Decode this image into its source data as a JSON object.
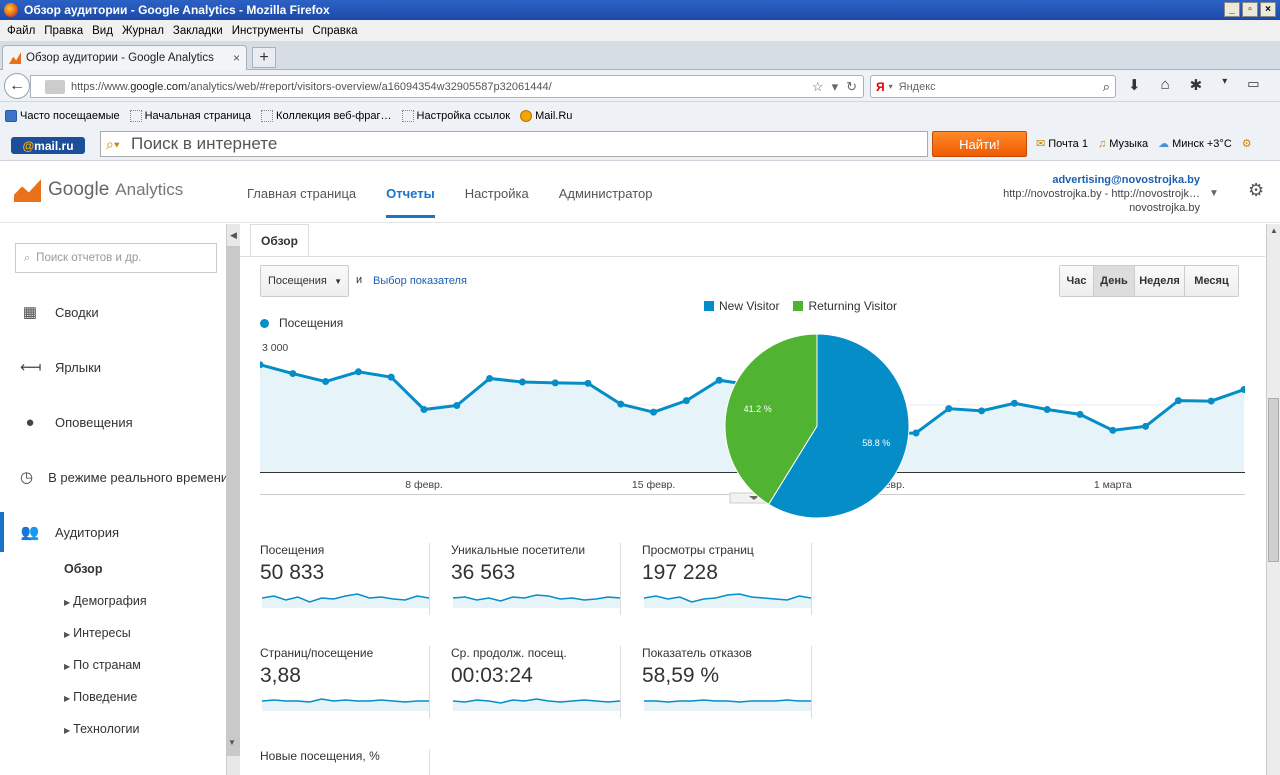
{
  "window": {
    "title": "Обзор аудитории - Google Analytics - Mozilla Firefox"
  },
  "menu": [
    "Файл",
    "Правка",
    "Вид",
    "Журнал",
    "Закладки",
    "Инструменты",
    "Справка"
  ],
  "tab": {
    "label": "Обзор аудитории - Google Analytics",
    "new_label": "+"
  },
  "url": {
    "prefix": "https://www.",
    "host": "google.com",
    "path": "/analytics/web/#report/visitors-overview/a16094354w32905587p32061444/"
  },
  "search": {
    "engine_icon": "Я",
    "placeholder": "Яндекс"
  },
  "bookmarks": [
    "Часто посещаемые",
    "Начальная страница",
    "Коллекция веб-фраг…",
    "Настройка ссылок",
    "Mail.Ru"
  ],
  "mailru": {
    "logo_at": "@",
    "logo_text": "mail.ru",
    "search_placeholder": "Поиск в интернете",
    "find_button": "Найти!",
    "mail": "Почта 1",
    "music": "Музыка",
    "weather": "Минск +3°C"
  },
  "ga": {
    "brand": "Google",
    "product": "Analytics",
    "nav": [
      "Главная страница",
      "Отчеты",
      "Настройка",
      "Администратор"
    ],
    "account": {
      "email": "advertising@novostrojka.by",
      "property": "http://novostrojka.by - http://novostrojk…",
      "view": "novostrojka.by"
    }
  },
  "sidebar": {
    "search_placeholder": "Поиск отчетов и др.",
    "items": [
      "Сводки",
      "Ярлыки",
      "Оповещения",
      "В режиме реального времени",
      "Аудитория"
    ],
    "subitems": [
      "Обзор",
      "Демография",
      "Интересы",
      "По странам",
      "Поведение",
      "Технологии"
    ]
  },
  "report": {
    "tab": "Обзор",
    "metric_select": "Посещения",
    "and": "и",
    "choose_metric": "Выбор показателя",
    "granularity": [
      "Час",
      "День",
      "Неделя",
      "Месяц"
    ],
    "active_granularity": "День"
  },
  "chart_data": [
    {
      "type": "line",
      "series": [
        {
          "name": "Посещения",
          "values": [
            2420,
            2220,
            2040,
            2260,
            2140,
            1410,
            1500,
            2110,
            2030,
            2010,
            2000,
            1530,
            1350,
            1610,
            2070,
            1960,
            1900,
            1710,
            1050,
            860,
            880,
            1430,
            1380,
            1550,
            1410,
            1300,
            940,
            1030,
            1610,
            1600,
            1860
          ]
        }
      ],
      "ylabels": [
        "3 000",
        "1 500"
      ],
      "yticks": [
        3000,
        1500
      ],
      "ylim": [
        0,
        3000
      ],
      "xlabels": [
        {
          "i": 5,
          "label": "8 февр."
        },
        {
          "i": 12,
          "label": "15 февр."
        },
        {
          "i": 19,
          "label": "22 февр."
        },
        {
          "i": 26,
          "label": "1 марта"
        }
      ],
      "color": "#058dc7"
    },
    {
      "type": "pie",
      "legend": [
        "New Visitor",
        "Returning Visitor"
      ],
      "values": [
        58.8,
        41.2
      ],
      "labels": [
        "58.8 %",
        "41.2 %"
      ],
      "colors": [
        "#058dc7",
        "#50b432"
      ]
    }
  ],
  "metrics": [
    {
      "label": "Посещения",
      "value": "50 833"
    },
    {
      "label": "Уникальные посетители",
      "value": "36 563"
    },
    {
      "label": "Просмотры страниц",
      "value": "197 228"
    },
    {
      "label": "Страниц/посещение",
      "value": "3,88"
    },
    {
      "label": "Ср. продолж. посещ.",
      "value": "00:03:24"
    },
    {
      "label": "Показатель отказов",
      "value": "58,59 %"
    },
    {
      "label": "Новые посещения, %",
      "value": ""
    }
  ]
}
